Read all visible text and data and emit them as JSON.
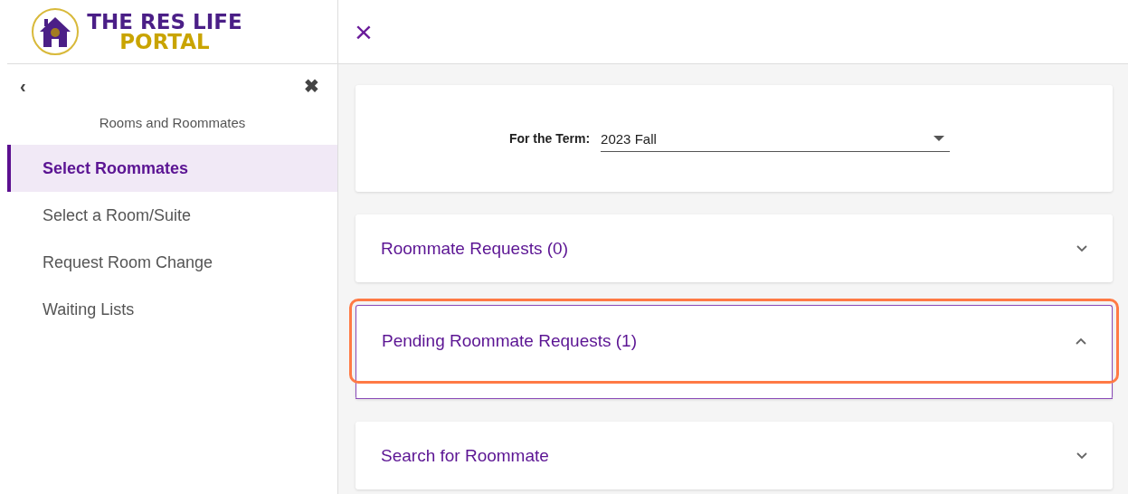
{
  "logo": {
    "line_1": "THE RES LIFE",
    "line_2": "PORTAL"
  },
  "header": {
    "close": "×"
  },
  "sidebar": {
    "back": "‹",
    "close": "✖",
    "heading": "Rooms and Roommates",
    "items": [
      {
        "label": "Select Roommates",
        "selected": true
      },
      {
        "label": "Select a Room/Suite",
        "selected": false
      },
      {
        "label": "Request Room Change",
        "selected": false
      },
      {
        "label": "Waiting Lists",
        "selected": false
      }
    ]
  },
  "term": {
    "label": "For the Term:",
    "value": "2023 Fall"
  },
  "sections": [
    {
      "title": "Roommate Requests (0)",
      "expanded": false,
      "highlighted": false
    },
    {
      "title": "Pending Roommate Requests (1)",
      "expanded": true,
      "highlighted": true
    },
    {
      "title": "Search for Roommate",
      "expanded": false,
      "highlighted": false
    }
  ]
}
